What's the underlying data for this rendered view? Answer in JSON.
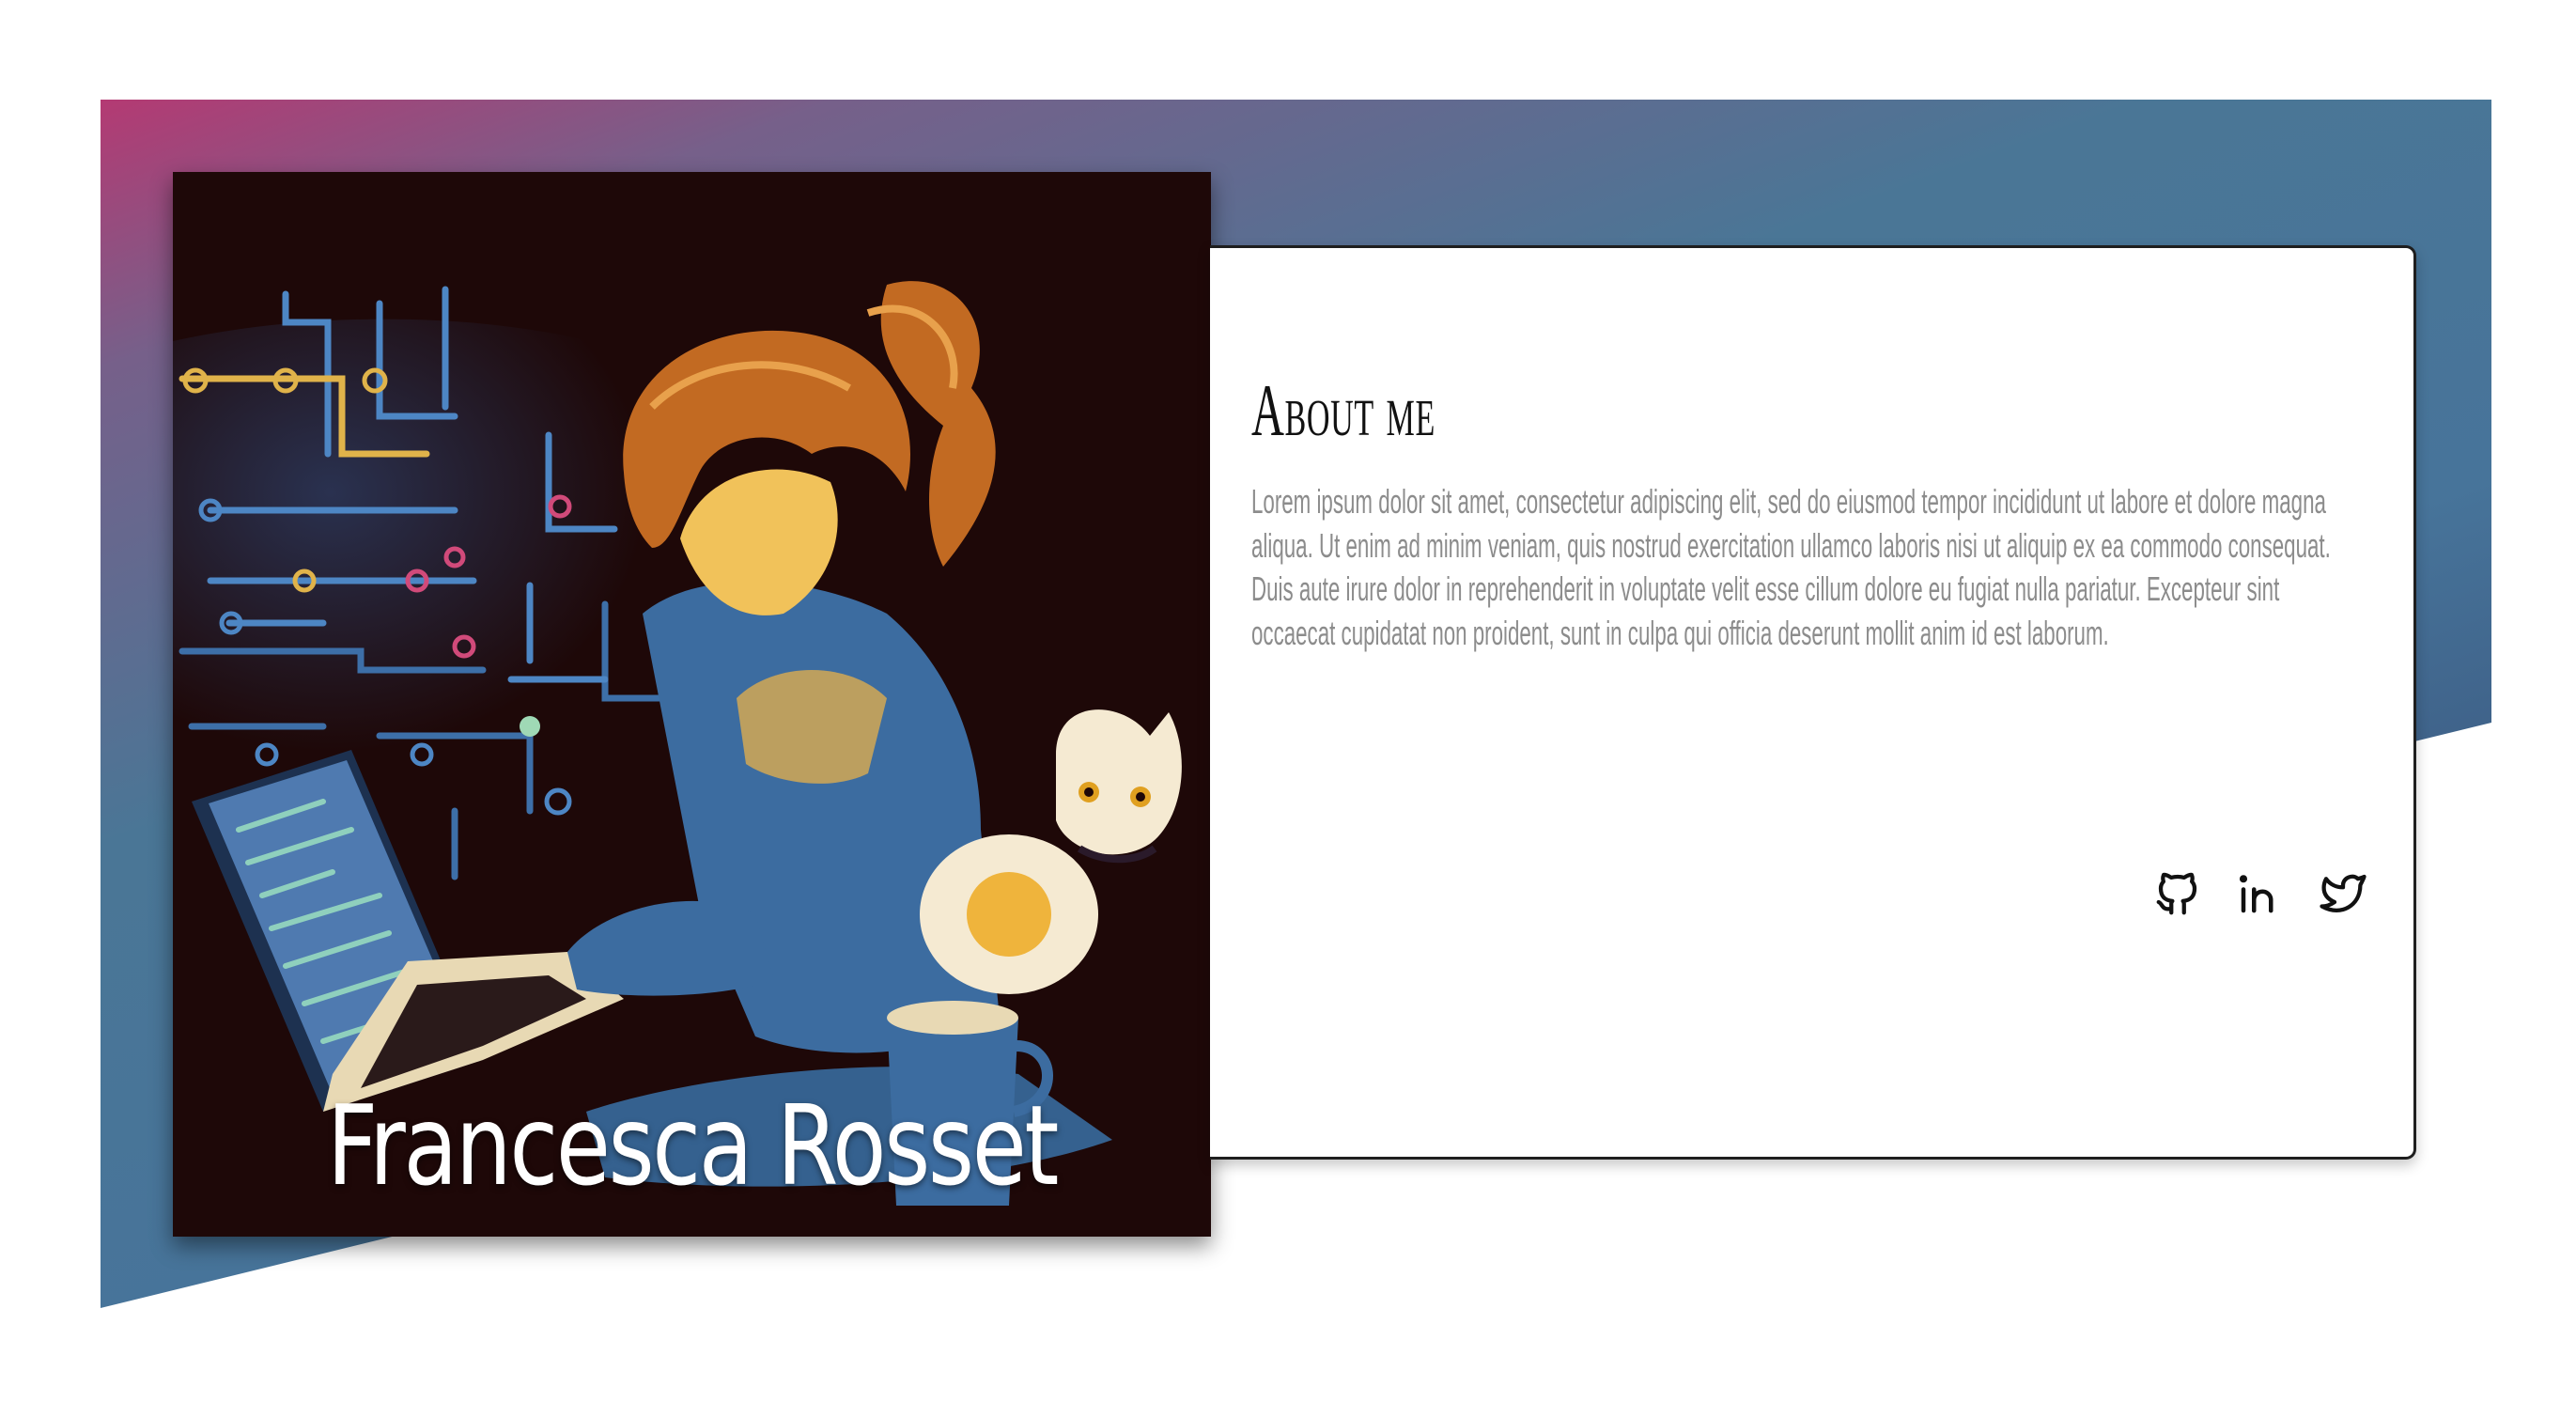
{
  "profile": {
    "name": "Francesca Rosset"
  },
  "about": {
    "title": "About me",
    "body": "Lorem ipsum dolor sit amet, consectetur adipiscing elit, sed do eiusmod tempor incididunt ut labore et dolore magna aliqua. Ut enim ad minim veniam, quis nostrud exercitation ullamco laboris nisi ut aliquip ex ea commodo consequat. Duis aute irure dolor in reprehenderit in voluptate velit esse cillum dolore eu fugiat nulla pariatur. Excepteur sint occaecat cupidatat non proident, sunt in culpa qui officia deserunt mollit anim id est laborum."
  },
  "social_links": [
    {
      "icon": "github-icon"
    },
    {
      "icon": "linkedin-icon"
    },
    {
      "icon": "twitter-icon"
    }
  ],
  "colors": {
    "gradient_start": "#b43a73",
    "gradient_mid": "#47749a",
    "gradient_end": "#2e3c66",
    "portrait_background": "#1e0808",
    "body_text": "#8c8c8c",
    "title_text": "#111111"
  }
}
